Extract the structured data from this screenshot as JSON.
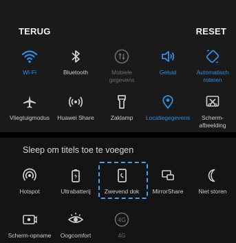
{
  "header": {
    "back_label": "TERUG",
    "reset_label": "RESET"
  },
  "colors": {
    "active": "#2e8fe6",
    "inactive": "#cfcfcf",
    "disabled": "#6e6e6e",
    "highlight": "#46a2ea"
  },
  "active_tiles": [
    {
      "label": "Wi-Fi",
      "icon": "wifi-icon",
      "state": "on"
    },
    {
      "label": "Bluetooth",
      "icon": "bluetooth-icon",
      "state": "off"
    },
    {
      "label": "Mobiele gegevens",
      "icon": "mobile-data-icon",
      "state": "disabled"
    },
    {
      "label": "Geluid",
      "icon": "sound-icon",
      "state": "on"
    },
    {
      "label": "Automatisch roteren",
      "icon": "auto-rotate-icon",
      "state": "on"
    },
    {
      "label": "Vliegtuigmodus",
      "icon": "airplane-icon",
      "state": "off"
    },
    {
      "label": "Huawei Share",
      "icon": "huawei-share-icon",
      "state": "off"
    },
    {
      "label": "Zaklamp",
      "icon": "flashlight-icon",
      "state": "off"
    },
    {
      "label": "Locatiegegevens",
      "icon": "location-icon",
      "state": "on"
    },
    {
      "label": "Scherm-afbeelding",
      "icon": "screenshot-icon",
      "state": "off"
    }
  ],
  "hint": "Sleep om titels toe te voegen",
  "inactive_tiles": [
    {
      "label": "Hotspot",
      "icon": "hotspot-icon"
    },
    {
      "label": "Ultrabatterij",
      "icon": "ultra-battery-icon"
    },
    {
      "label": "Zwevend dok",
      "icon": "floating-dock-icon"
    },
    {
      "label": "MirrorShare",
      "icon": "mirrorshare-icon"
    },
    {
      "label": "Niet storen",
      "icon": "do-not-disturb-icon"
    },
    {
      "label": "Scherm-opname",
      "icon": "screen-record-icon"
    },
    {
      "label": "Oogcomfort",
      "icon": "eye-comfort-icon"
    },
    {
      "label": "4G",
      "icon": "4g-icon"
    }
  ]
}
